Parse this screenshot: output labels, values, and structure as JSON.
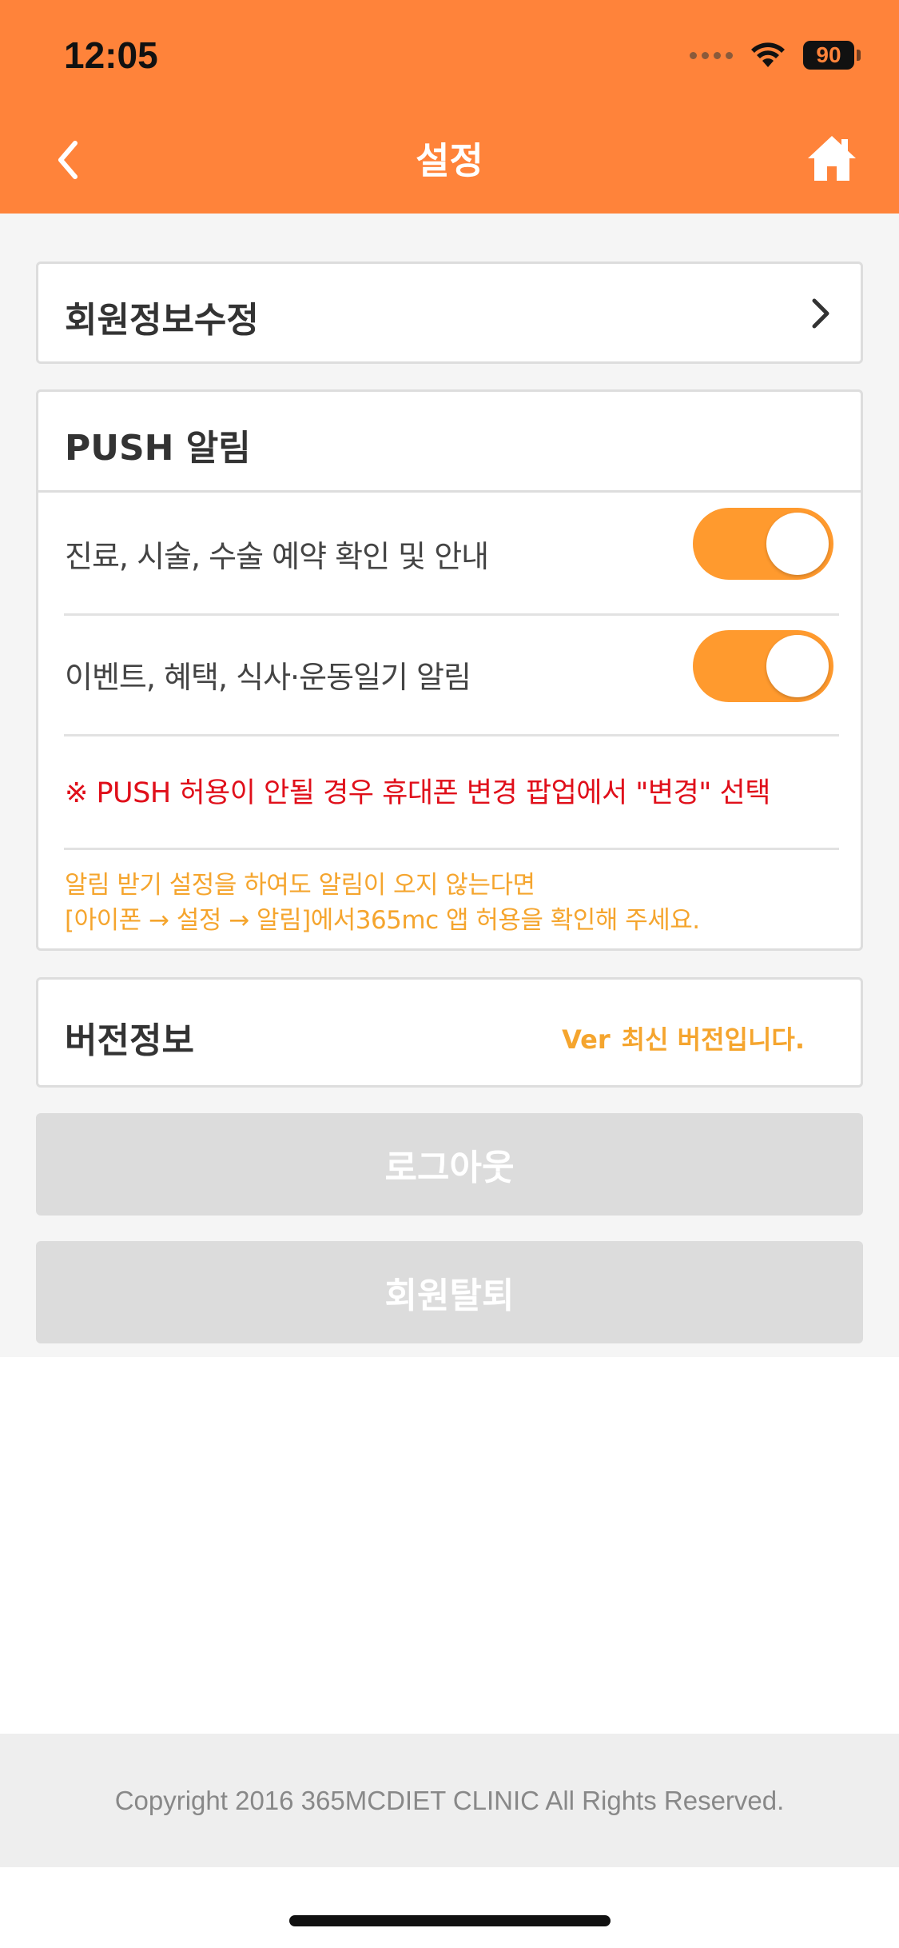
{
  "status_bar": {
    "time": "12:05",
    "battery": "90"
  },
  "header": {
    "title": "설정"
  },
  "profile": {
    "label": "회원정보수정"
  },
  "push": {
    "title": "PUSH 알림",
    "items": [
      {
        "label": "진료, 시술, 수술 예약 확인 및 안내",
        "enabled": true
      },
      {
        "label": "이벤트, 혜택, 식사·운동일기 알림",
        "enabled": true
      }
    ],
    "notice": "※ PUSH 허용이 안될 경우 휴대폰 변경 팝업에서 \"변경\" 선택",
    "help_line1": "알림 받기 설정을 하여도 알림이 오지 않는다면",
    "help_line2": "[아이폰 → 설정 → 알림]에서365mc 앱 허용을 확인해 주세요."
  },
  "version": {
    "label": "버전정보",
    "prefix": "Ver",
    "value": "최신 버전입니다."
  },
  "buttons": {
    "logout": "로그아웃",
    "withdraw": "회원탈퇴"
  },
  "footer": {
    "copyright": "Copyright 2016 365MCDIET CLINIC All Rights Reserved."
  },
  "colors": {
    "header": "#FF833A",
    "toggle_on": "#FF9A2E",
    "notice": "#E00F1A",
    "help": "#F5A52E",
    "button_disabled": "#DCDCDC"
  },
  "icons": {
    "back": "chevron-left-icon",
    "home": "home-icon",
    "profile": "chevron-right-icon"
  }
}
